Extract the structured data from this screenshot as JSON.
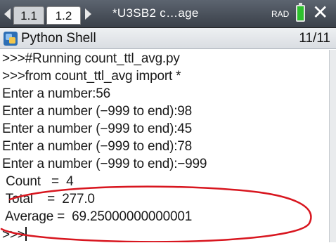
{
  "tabbar": {
    "tabs": [
      {
        "label": "1.1"
      },
      {
        "label": "1.2"
      }
    ],
    "document_title": "*U3SB2 c…age",
    "angle_mode": "RAD"
  },
  "app": {
    "title": "Python Shell",
    "page_indicator": "11/11"
  },
  "shell": {
    "lines": [
      ">>>#Running count_ttl_avg.py",
      ">>>from count_ttl_avg import *",
      "Enter a number:56",
      "Enter a number (−999 to end):98",
      "Enter a number (−999 to end):45",
      "Enter a number (−999 to end):78",
      "Enter a number (−999 to end):−999",
      " Count   =  4",
      " Total    =  277.0",
      " Average =  69.25000000000001"
    ],
    "prompt": ">>>"
  },
  "colors": {
    "annotation": "#d8161f",
    "tabbar": "#3a4049",
    "battery": "#2ec12e"
  }
}
